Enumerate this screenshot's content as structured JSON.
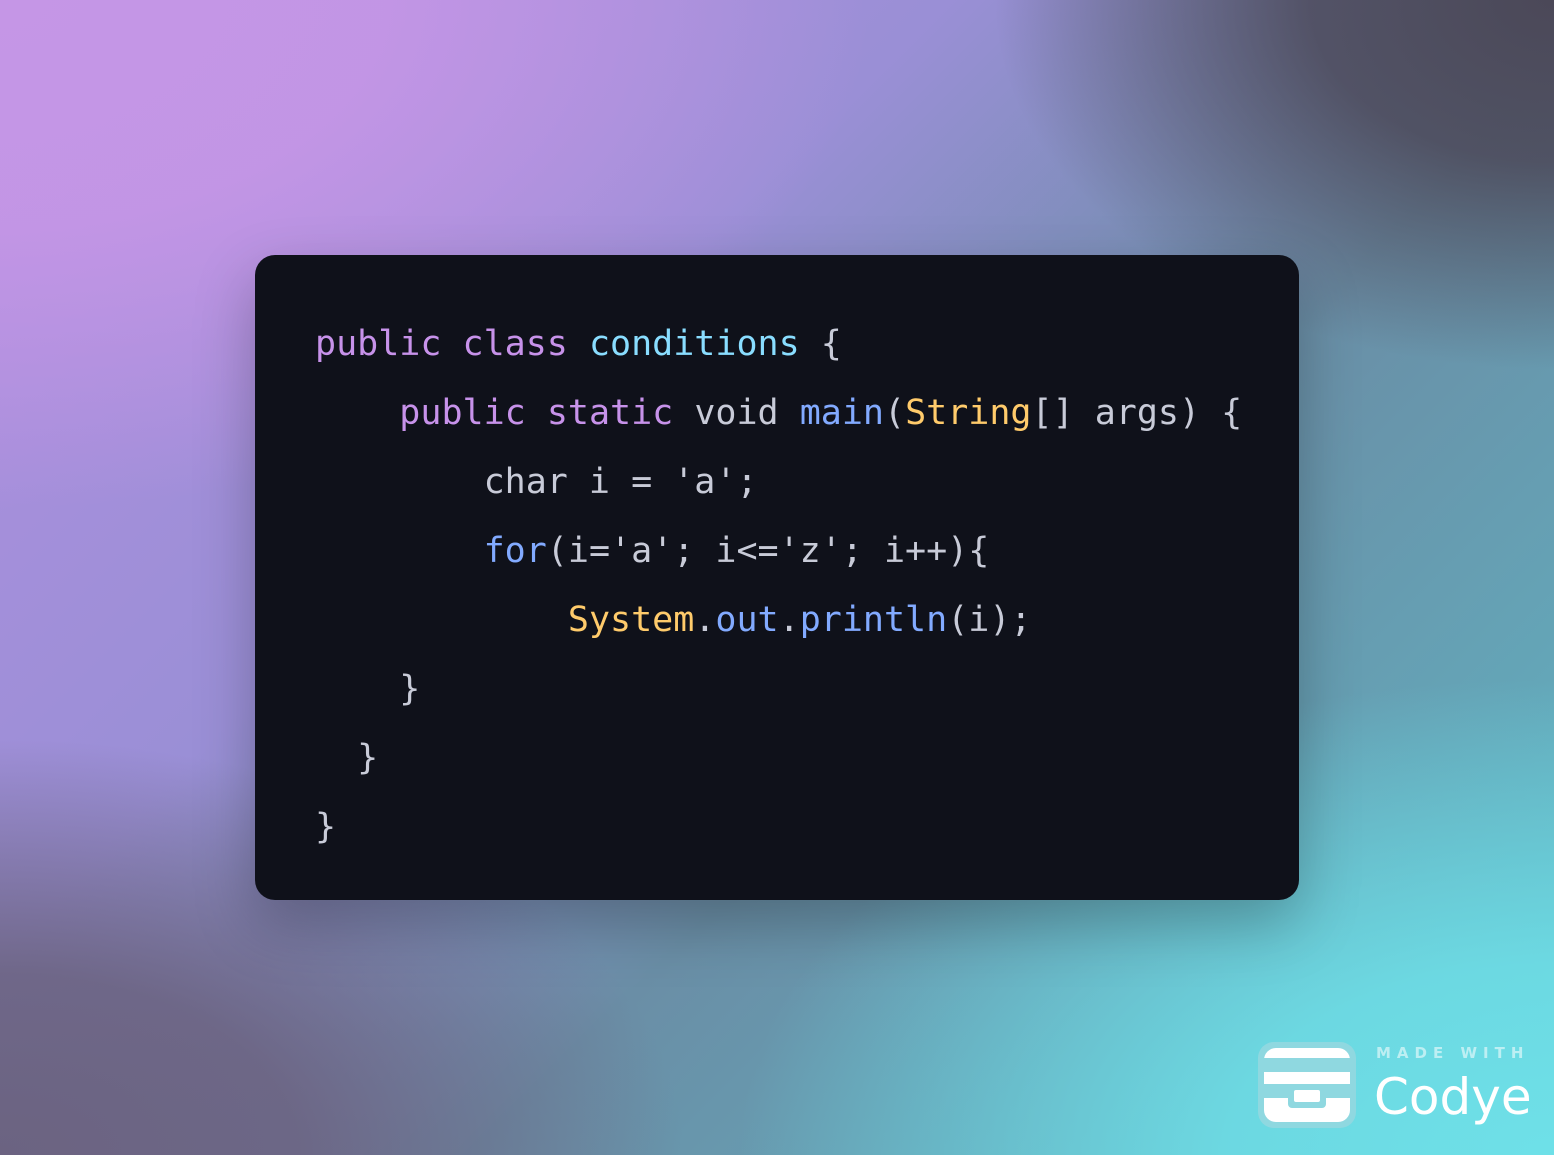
{
  "code": {
    "lines": [
      {
        "indent": "",
        "tokens": [
          {
            "t": "public",
            "c": "kw"
          },
          {
            "t": " ",
            "c": "plain"
          },
          {
            "t": "class",
            "c": "kw"
          },
          {
            "t": " ",
            "c": "plain"
          },
          {
            "t": "conditions",
            "c": "class"
          },
          {
            "t": " {",
            "c": "punct"
          }
        ]
      },
      {
        "indent": "    ",
        "tokens": [
          {
            "t": "public",
            "c": "kw"
          },
          {
            "t": " ",
            "c": "plain"
          },
          {
            "t": "static",
            "c": "kw"
          },
          {
            "t": " void ",
            "c": "plain"
          },
          {
            "t": "main",
            "c": "fn"
          },
          {
            "t": "(",
            "c": "punct"
          },
          {
            "t": "String",
            "c": "type"
          },
          {
            "t": "[] args) {",
            "c": "punct"
          }
        ]
      },
      {
        "indent": "        ",
        "tokens": [
          {
            "t": "char i = 'a';",
            "c": "plain"
          }
        ]
      },
      {
        "indent": "        ",
        "tokens": [
          {
            "t": "for",
            "c": "ctrl"
          },
          {
            "t": "(i='a'; i<='z'; i++){",
            "c": "punct"
          }
        ]
      },
      {
        "indent": "            ",
        "tokens": [
          {
            "t": "System",
            "c": "type"
          },
          {
            "t": ".",
            "c": "punct"
          },
          {
            "t": "out",
            "c": "fn"
          },
          {
            "t": ".",
            "c": "punct"
          },
          {
            "t": "println",
            "c": "fn"
          },
          {
            "t": "(i);",
            "c": "punct"
          }
        ]
      },
      {
        "indent": "    ",
        "tokens": [
          {
            "t": "}",
            "c": "punct"
          }
        ]
      },
      {
        "indent": "  ",
        "tokens": [
          {
            "t": "}",
            "c": "punct"
          }
        ]
      },
      {
        "indent": "",
        "tokens": [
          {
            "t": "}",
            "c": "punct"
          }
        ]
      }
    ]
  },
  "watermark": {
    "made_with": "MADE WITH",
    "brand": "Codye",
    "icon": "codye-logo-icon"
  },
  "colors": {
    "card_background": "#0f111a",
    "keyword": "#c792ea",
    "class_name": "#89ddff",
    "type": "#ffcb6b",
    "function": "#82aaff",
    "text": "#c8cbd8"
  }
}
